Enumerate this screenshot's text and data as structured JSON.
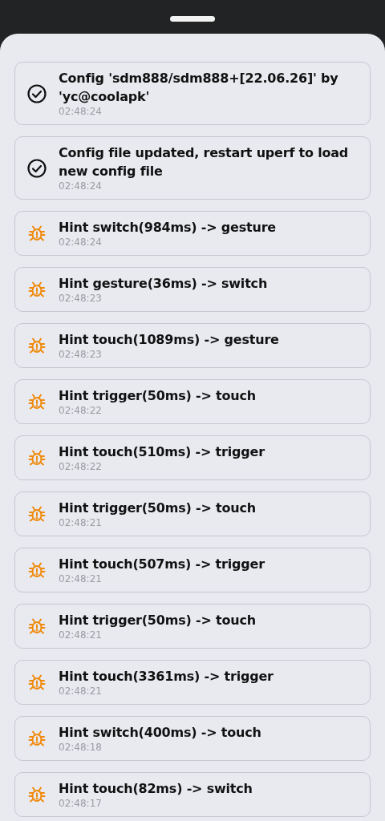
{
  "logs": [
    {
      "kind": "success",
      "message": "Config 'sdm888/sdm888+[22.06.26]' by 'yc@coolapk'",
      "time": "02:48:24"
    },
    {
      "kind": "success",
      "message": "Config file updated, restart uperf to load new config file",
      "time": "02:48:24"
    },
    {
      "kind": "debug",
      "message": "Hint switch(984ms) -> gesture",
      "time": "02:48:24"
    },
    {
      "kind": "debug",
      "message": "Hint gesture(36ms) -> switch",
      "time": "02:48:23"
    },
    {
      "kind": "debug",
      "message": "Hint touch(1089ms) -> gesture",
      "time": "02:48:23"
    },
    {
      "kind": "debug",
      "message": "Hint trigger(50ms) -> touch",
      "time": "02:48:22"
    },
    {
      "kind": "debug",
      "message": "Hint touch(510ms) -> trigger",
      "time": "02:48:22"
    },
    {
      "kind": "debug",
      "message": "Hint trigger(50ms) -> touch",
      "time": "02:48:21"
    },
    {
      "kind": "debug",
      "message": "Hint touch(507ms) -> trigger",
      "time": "02:48:21"
    },
    {
      "kind": "debug",
      "message": "Hint trigger(50ms) -> touch",
      "time": "02:48:21"
    },
    {
      "kind": "debug",
      "message": "Hint touch(3361ms) -> trigger",
      "time": "02:48:21"
    },
    {
      "kind": "debug",
      "message": "Hint switch(400ms) -> touch",
      "time": "02:48:18"
    },
    {
      "kind": "debug",
      "message": "Hint touch(82ms) -> switch",
      "time": "02:48:17"
    }
  ]
}
